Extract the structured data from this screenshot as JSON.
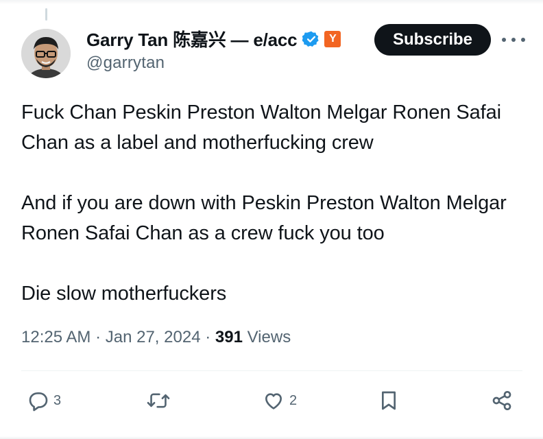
{
  "author": {
    "display_name": "Garry Tan 陈嘉兴 — e/acc",
    "handle": "@garrytan",
    "verified_color": "#1d9bf0",
    "affiliate_badge_icon": "y-combinator-icon",
    "affiliate_badge_text": "Y",
    "affiliate_badge_color": "#f26522"
  },
  "subscribe_label": "Subscribe",
  "tweet": {
    "paragraphs": [
      "Fuck Chan Peskin Preston Walton Melgar Ronen Safai Chan as a label and motherfucking crew",
      "And if you are down with Peskin Preston Walton Melgar Ronen Safai Chan as a crew fuck you too",
      "Die slow motherfuckers"
    ]
  },
  "meta": {
    "time": "12:25 AM",
    "separator": "·",
    "date": "Jan 27, 2024",
    "views_count": "391",
    "views_label": "Views"
  },
  "actions": {
    "reply_icon": "reply-icon",
    "reply_count": "3",
    "retweet_icon": "retweet-icon",
    "retweet_count": "",
    "like_icon": "heart-icon",
    "like_count": "2",
    "bookmark_icon": "bookmark-icon",
    "share_icon": "share-icon"
  },
  "colors": {
    "text_primary": "#0f1419",
    "text_secondary": "#536471",
    "subscribe_bg": "#0f1419"
  }
}
